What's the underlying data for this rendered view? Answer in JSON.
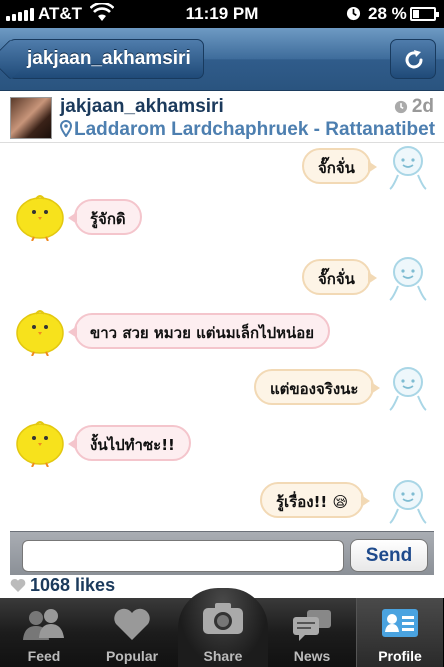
{
  "status_bar": {
    "carrier": "AT&T",
    "time": "11:19 PM",
    "battery_percent": "28 %",
    "battery_level": 0.28,
    "icons": [
      "signal-icon",
      "wifi-icon",
      "clock-icon",
      "battery-icon"
    ]
  },
  "nav": {
    "back_label": "jakjaan_akhamsiri",
    "refresh_icon": "refresh-icon"
  },
  "post": {
    "username": "jakjaan_akhamsiri",
    "time_ago": "2d",
    "location": "Laddarom Lardchaphruek - Rattanatibet"
  },
  "chat": {
    "messages": [
      {
        "side": "right",
        "text": "จั๊กจั่น"
      },
      {
        "side": "left",
        "text": "รู้จักดิ"
      },
      {
        "side": "right",
        "text": "จั๊กจั่น"
      },
      {
        "side": "left",
        "text": "ขาว สวย หมวย แต่นมเล็กไปหน่อย"
      },
      {
        "side": "right",
        "text": "แต่ของจริงนะ"
      },
      {
        "side": "left",
        "text": "งั้นไปทำซะ!!"
      },
      {
        "side": "right",
        "text": "รู้เรื่อง!! 😪"
      }
    ]
  },
  "comment": {
    "placeholder": "",
    "send_label": "Send"
  },
  "likes": {
    "text": "1068 likes"
  },
  "tabs": [
    {
      "label": "Feed",
      "icon": "people-icon"
    },
    {
      "label": "Popular",
      "icon": "heart-icon"
    },
    {
      "label": "Share",
      "icon": "camera-icon"
    },
    {
      "label": "News",
      "icon": "speech-bubbles-icon"
    },
    {
      "label": "Profile",
      "icon": "profile-card-icon"
    }
  ]
}
